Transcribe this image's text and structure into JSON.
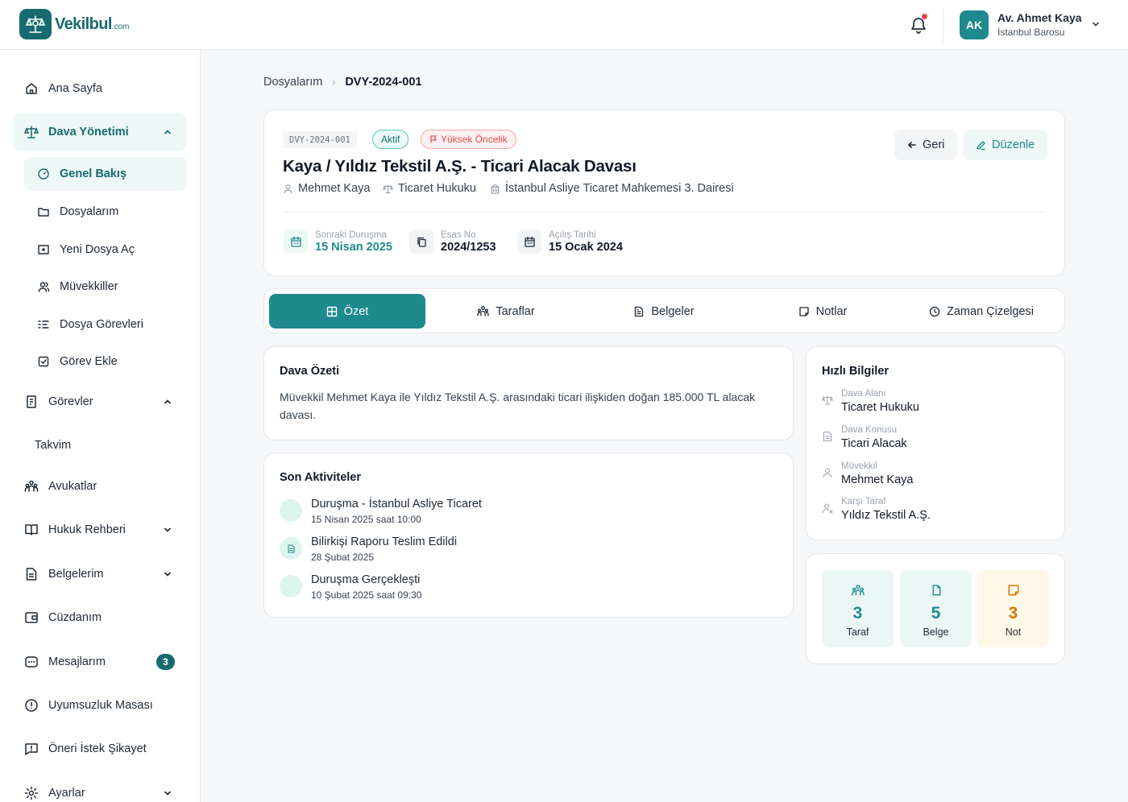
{
  "brand": {
    "name": "Vekilbul",
    "suffix": ".com",
    "color": "#176b6e"
  },
  "header": {
    "avatar_initials": "AK",
    "user_name": "Av. Ahmet Kaya",
    "user_org": "İstanbul Barosu",
    "notification_dot": true
  },
  "sidebar": {
    "home": "Ana Sayfa",
    "case_management": "Dava Yönetimi",
    "overview": "Genel Bakış",
    "my_files": "Dosyalarım",
    "new_file": "Yeni Dosya Aç",
    "clients": "Müvekkiller",
    "file_tasks": "Dosya Görevleri",
    "add_task": "Görev Ekle",
    "tasks": "Görevler",
    "calendar": "Takvim",
    "lawyers": "Avukatlar",
    "legal_guide": "Hukuk Rehberi",
    "my_documents": "Belgelerim",
    "wallet": "Cüzdanım",
    "messages": "Mesajlarım",
    "messages_badge": "3",
    "disputes": "Uyumsuzluk Masası",
    "feedback": "Öneri İstek Şikayet",
    "settings": "Ayarlar"
  },
  "breadcrumb": {
    "parent": "Dosyalarım",
    "current": "DVY-2024-001"
  },
  "case": {
    "code": "DVY-2024-001",
    "status": "Aktif",
    "priority": "Yüksek Öncelik",
    "title": "Kaya / Yıldız Tekstil A.Ş. - Ticari Alacak Davası",
    "client": "Mehmet Kaya",
    "field": "Ticaret Hukuku",
    "court": "İstanbul Asliye Ticaret Mahkemesi 3. Dairesi",
    "next_hearing_label": "Sonraki Duruşma",
    "next_hearing": "15 Nisan 2025",
    "file_no_label": "Esas No",
    "file_no": "2024/1253",
    "opened_label": "Açılış Tarihi",
    "opened": "15 Ocak 2024",
    "back_label": "Geri",
    "edit_label": "Düzenle"
  },
  "tabs": [
    {
      "label": "Özet",
      "icon": "grid-icon",
      "active": true
    },
    {
      "label": "Taraflar",
      "icon": "users-icon",
      "active": false
    },
    {
      "label": "Belgeler",
      "icon": "document-icon",
      "active": false
    },
    {
      "label": "Notlar",
      "icon": "note-icon",
      "active": false
    },
    {
      "label": "Zaman Çizelgesi",
      "icon": "clock-icon",
      "active": false
    }
  ],
  "summary": {
    "title": "Dava Özeti",
    "text": "Müvekkil Mehmet Kaya ile Yıldız Tekstil A.Ş. arasındaki ticari ilişkiden doğan 185.000 TL alacak davası."
  },
  "activities": {
    "title": "Son Aktiviteler",
    "items": [
      {
        "title": "Duruşma - İstanbul Asliye Ticaret",
        "date": "15 Nisan 2025 saat 10:00",
        "icon": "dot"
      },
      {
        "title": "Bilirkişi Raporu Teslim Edildi",
        "date": "28 Şubat 2025",
        "icon": "document-icon"
      },
      {
        "title": "Duruşma Gerçekleşti",
        "date": "10 Şubat 2025 saat 09:30",
        "icon": "dot"
      }
    ]
  },
  "quick_info": {
    "title": "Hızlı Bilgiler",
    "items": [
      {
        "label": "Dava Alanı",
        "value": "Ticaret Hukuku",
        "icon": "scale-icon"
      },
      {
        "label": "Dava Konusu",
        "value": "Ticari Alacak",
        "icon": "document-icon"
      },
      {
        "label": "Müvekkil",
        "value": "Mehmet Kaya",
        "icon": "user-icon"
      },
      {
        "label": "Karşı Taraf",
        "value": "Yıldız Tekstil A.Ş.",
        "icon": "user-x-icon"
      }
    ]
  },
  "stats": [
    {
      "value": "3",
      "label": "Taraf",
      "icon": "users-icon",
      "color": "#1e8a8e",
      "bg": "#eaf7f5"
    },
    {
      "value": "5",
      "label": "Belge",
      "icon": "copy-icon",
      "color": "#1e8a8e",
      "bg": "#eaf7f5"
    },
    {
      "value": "3",
      "label": "Not",
      "icon": "note-icon",
      "color": "#d97706",
      "bg": "#fff8e8"
    }
  ]
}
